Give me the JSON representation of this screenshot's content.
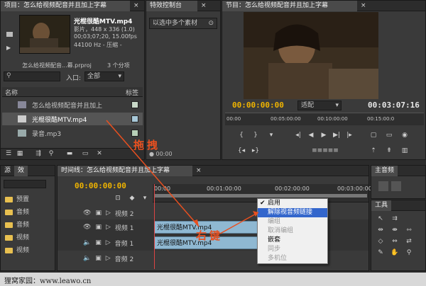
{
  "project": {
    "tab": "项目：怎么给视频配音并且加上字幕",
    "tab2": "特效控制台",
    "clip_name": "光棍很酷MTV.mp4",
    "clip_info1": "影片，448 x 336 (1.0)",
    "clip_info2": "00;03;07;20, 15.00fps",
    "clip_info3": "44100 Hz - 压缩 -",
    "project_file": "怎么给视频配音...幕.prproj",
    "item_count": "3 个分项",
    "entry_label": "入口:",
    "entry_value": "全部",
    "col_name": "名称",
    "col_label": "标签",
    "items": [
      {
        "name": "怎么给视频配音并且加上",
        "color": "#c8d8c8"
      },
      {
        "name": "光棍很酷MTV.mp4",
        "color": "#a8c8d8"
      },
      {
        "name": "录音.mp3",
        "color": "#b8d0b8"
      }
    ]
  },
  "effects": {
    "notice": "以选中多个素材",
    "time": "00:00"
  },
  "program": {
    "tab": "节目：怎么给视频配音并且加上字幕",
    "time_current": "00:00:00:00",
    "fit": "适配",
    "time_total": "00:03:07:16",
    "ruler": [
      "00:00",
      "00:05:00:00",
      "00:10:00:00",
      "00:15:00:0"
    ]
  },
  "left_bottom": {
    "tab1": "源",
    "tab2": "效",
    "items": [
      "预置",
      "音频",
      "音频",
      "视频",
      "视频"
    ]
  },
  "timeline": {
    "tab": "时间线：怎么给视频配音并且加上字幕",
    "time": "00:00:00:00",
    "ruler": [
      "00:00",
      "00:01:00:00",
      "00:02:00:00",
      "00:03:00:00"
    ],
    "tracks": [
      {
        "name": "视频 2",
        "clip": ""
      },
      {
        "name": "视频 1",
        "clip": "光棍很酷MTV.mp4"
      },
      {
        "name": "音频 1",
        "clip": "光棍很酷MTV.mp4"
      },
      {
        "name": "音频 2",
        "clip": ""
      }
    ]
  },
  "right": {
    "mixer_tab": "主音频",
    "tools_tab": "工具"
  },
  "context_menu": {
    "items": [
      {
        "label": "启用",
        "checked": true,
        "disabled": false,
        "highlight": false
      },
      {
        "label": "解除视音频链接",
        "checked": false,
        "disabled": false,
        "highlight": true
      },
      {
        "label": "编组",
        "checked": false,
        "disabled": true,
        "highlight": false
      },
      {
        "label": "取消编组",
        "checked": false,
        "disabled": true,
        "highlight": false
      },
      {
        "label": "嵌套",
        "checked": false,
        "disabled": false,
        "highlight": false
      },
      {
        "label": "同步",
        "checked": false,
        "disabled": true,
        "highlight": false
      },
      {
        "label": "多机位",
        "checked": false,
        "disabled": true,
        "highlight": false
      }
    ]
  },
  "annotations": {
    "drag": "拖拽",
    "rightclick": "右键"
  },
  "watermark": "狸窝家园：www.leawo.cn",
  "colors": {
    "timecode": "#f0b400",
    "annotation": "#e85020",
    "clip_fill": "#8fb8d2",
    "highlight": "#3366cc"
  }
}
